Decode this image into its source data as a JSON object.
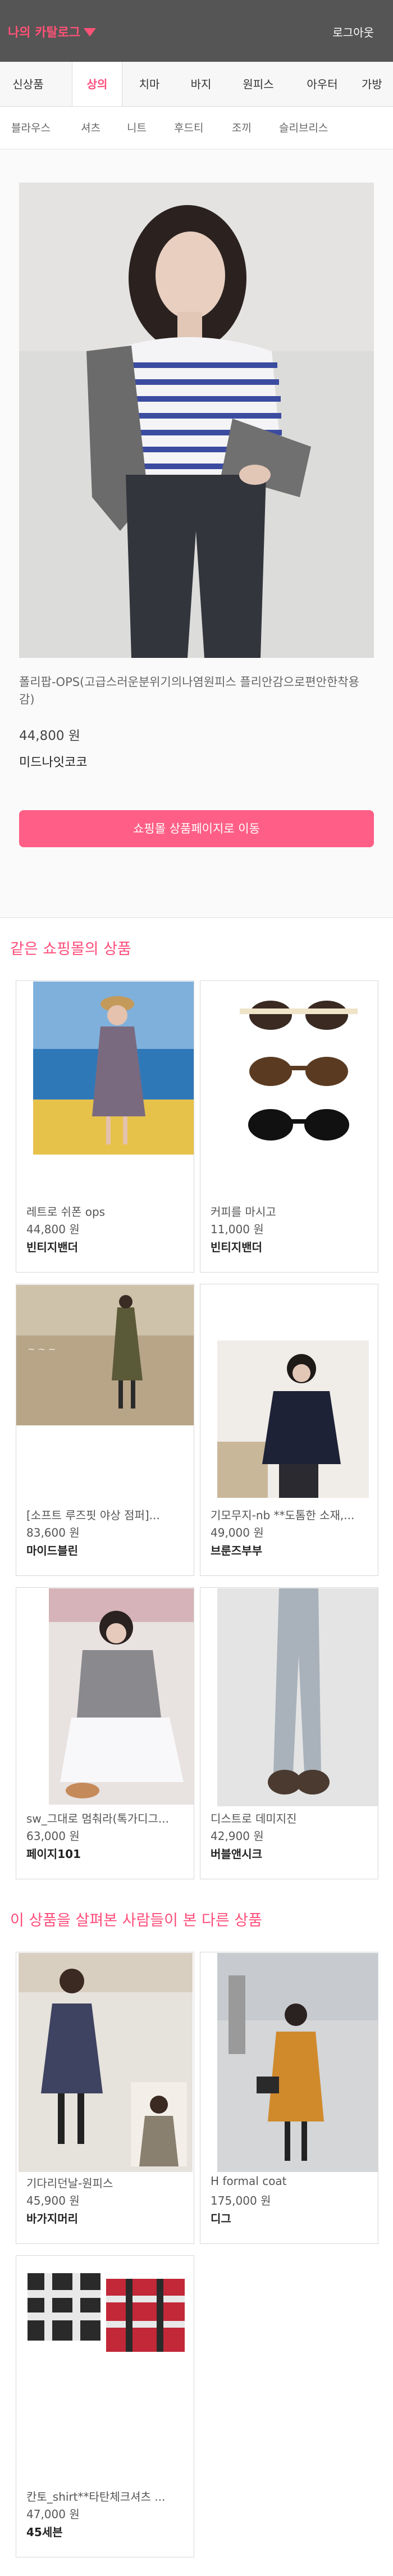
{
  "header": {
    "catalog_label": "나의 카탈로그",
    "logout_label": "로그아웃"
  },
  "main_tabs": [
    "신상품",
    "상의",
    "치마",
    "바지",
    "원피스",
    "아우터",
    "가방"
  ],
  "sub_tabs": [
    "블라우스",
    "셔츠",
    "니트",
    "후드티",
    "조끼",
    "슬리브리스"
  ],
  "product": {
    "name": "폴리팝-OPS(고급스러운분위기의나염원피스 플리안감으로편안한착용감)",
    "price": "44,800 원",
    "shop": "미드나잇코코",
    "go_button": "쇼핑몰 상품페이지로 이동"
  },
  "same_shop": {
    "title": "같은 쇼핑몰의 상품",
    "items": [
      {
        "title": "레트로 쉬폰 ops",
        "price": "44,800 원",
        "shop": "빈티지밴더"
      },
      {
        "title": "커피를 마시고",
        "price": "11,000 원",
        "shop": "빈티지밴더"
      },
      {
        "title": "[소프트 루즈핏 야상 점퍼]...",
        "price": "83,600 원",
        "shop": "마이드블린"
      },
      {
        "title": "기모무지-nb **도톰한 소재,...",
        "price": "49,000 원",
        "shop": "브룬즈부부"
      },
      {
        "title": "sw_그대로 멈춰라(톡가디그...",
        "price": "63,000 원",
        "shop": "페이지101"
      },
      {
        "title": "디스트로 데미지진",
        "price": "42,900 원",
        "shop": "버블앤시크"
      }
    ]
  },
  "others": {
    "title": "이 상품을 살펴본 사람들이 본 다른 상품",
    "items": [
      {
        "title": "기다리던날-원피스",
        "price": "45,900 원",
        "shop": "바가지머리"
      },
      {
        "title": "H formal coat",
        "price": "175,000 원",
        "shop": "디그"
      },
      {
        "title": "칸토_shirt**타탄체크셔츠 ...",
        "price": "47,000 원",
        "shop": "45세븐"
      }
    ]
  }
}
